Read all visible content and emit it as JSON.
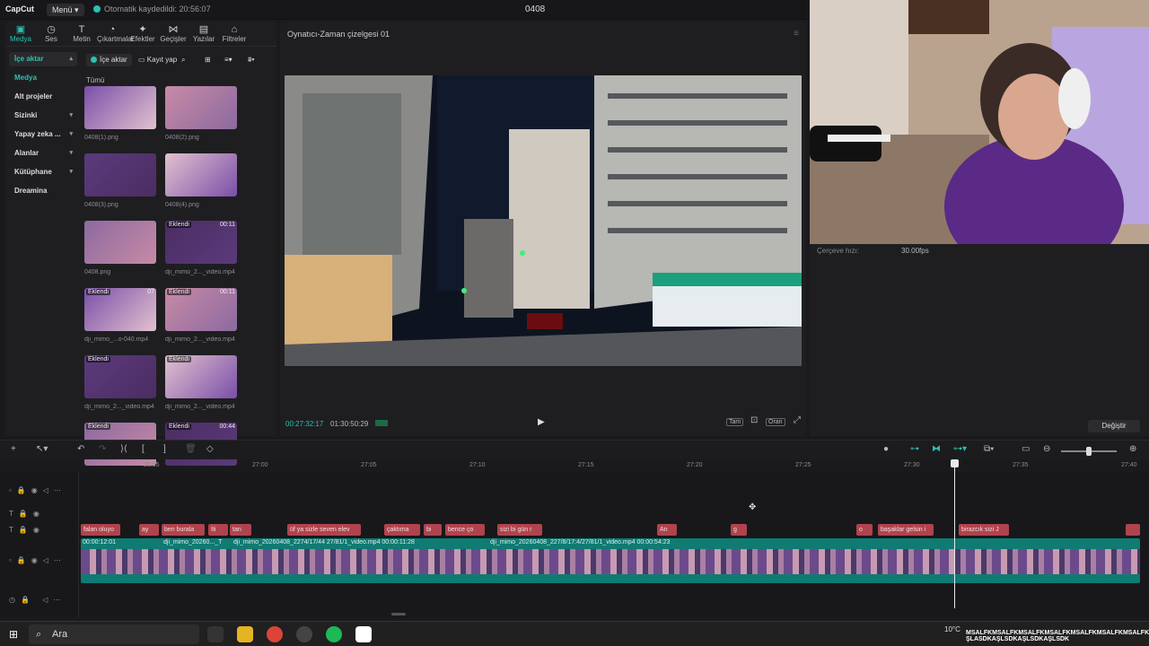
{
  "app": {
    "logo": "CapCut",
    "menu_label": "Menü",
    "autosave": "Otomatik kaydedildi: 20:56:07",
    "project_title": "0408"
  },
  "tool_tabs": [
    {
      "label": "Medya",
      "icon": "media-icon",
      "glyph": "▣",
      "active": true
    },
    {
      "label": "Ses",
      "icon": "audio-icon",
      "glyph": "◷"
    },
    {
      "label": "Metin",
      "icon": "text-icon",
      "glyph": "T"
    },
    {
      "label": "Çıkartmalar",
      "icon": "sticker-icon",
      "glyph": "◔"
    },
    {
      "label": "Efektler",
      "icon": "effects-icon",
      "glyph": "✦"
    },
    {
      "label": "Geçişler",
      "icon": "transitions-icon",
      "glyph": "⋈"
    },
    {
      "label": "Yazılar",
      "icon": "captions-icon",
      "glyph": "▤"
    },
    {
      "label": "Filtreler",
      "icon": "filters-icon",
      "glyph": "⌂"
    }
  ],
  "nav": [
    {
      "label": "İçe aktar",
      "state": "open"
    },
    {
      "label": "Medya",
      "state": "sub"
    },
    {
      "label": "Alt projeler",
      "state": ""
    },
    {
      "label": "Sizinki",
      "state": "caret"
    },
    {
      "label": "Yapay zeka ...",
      "state": "caret"
    },
    {
      "label": "Alanlar",
      "state": "caret"
    },
    {
      "label": "Kütüphane",
      "state": "caret"
    },
    {
      "label": "Dreamina",
      "state": ""
    }
  ],
  "media_toolbar": {
    "import": "İçe aktar",
    "record": "Kayıt yap"
  },
  "all_label": "Tümü",
  "media": [
    {
      "name": "0408(1).png",
      "badge": "",
      "dur": ""
    },
    {
      "name": "0408(2).png",
      "badge": "",
      "dur": ""
    },
    {
      "name": "0408(3).png",
      "badge": "",
      "dur": ""
    },
    {
      "name": "0408(4).png",
      "badge": "",
      "dur": ""
    },
    {
      "name": "0408.png",
      "badge": "",
      "dur": ""
    },
    {
      "name": "dji_mimo_2..._video.mp4",
      "badge": "Eklendi",
      "dur": "00:11"
    },
    {
      "name": "dji_mimo_...o-040.mp4",
      "badge": "Eklendi",
      "dur": "07"
    },
    {
      "name": "dji_mimo_2..._video.mp4",
      "badge": "Eklendi",
      "dur": "00:11"
    },
    {
      "name": "dji_mimo_2..._video.mp4",
      "badge": "Eklendi",
      "dur": ""
    },
    {
      "name": "dji_mimo_2..._video.mp4",
      "badge": "Eklendi",
      "dur": ""
    },
    {
      "name": "",
      "badge": "Eklendi",
      "dur": ""
    },
    {
      "name": "",
      "badge": "Eklendi",
      "dur": "00:44"
    }
  ],
  "player": {
    "title": "Oynatıcı-Zaman çizelgesi 01",
    "timecode_current": "00:27:32:17",
    "timecode_total": "01:30:50:29",
    "btn_full": "Tam",
    "btn_ratio": "Oran"
  },
  "details": {
    "fps_label": "Çerçeve hızı:",
    "fps_value": "30.00fps",
    "change_button": "Değiştir"
  },
  "ruler": [
    "26:55",
    "27:00",
    "27:05",
    "27:10",
    "27:15",
    "27:20",
    "27:25",
    "27:30",
    "27:35",
    "27:40"
  ],
  "captions": [
    {
      "text": "falan oluyo"
    },
    {
      "text": "ay"
    },
    {
      "text": "ben burala"
    },
    {
      "text": "İti"
    },
    {
      "text": "tan"
    },
    {
      "text": "üf ya sizle seven elev"
    },
    {
      "text": "çaktıma"
    },
    {
      "text": "bi"
    },
    {
      "text": "bence ço"
    },
    {
      "text": "sizi bi gün r"
    },
    {
      "text": "An"
    },
    {
      "text": "g"
    },
    {
      "text": "o"
    },
    {
      "text": "başaklar gelsin i"
    },
    {
      "text": "birazcık sizi J"
    },
    {
      "text": ""
    }
  ],
  "clips": [
    {
      "label": "00:00:12:01"
    },
    {
      "label": "dji_mimo_20260..._T"
    },
    {
      "label": "dji_mimo_20260408_2274/17/44 27/81/1_video.mp4  00:00:11:28"
    },
    {
      "label": "dji_mimo_20260408_227/8/17:4/27/81/1_video.mp4  00:00:54:23"
    }
  ],
  "taskbar": {
    "search": "Ara",
    "weather": "10°C",
    "ticker": "MSALFKMSALFKMSALFKMSALFKMSALFKMSALFKMSALFKMSALFA ŞLASDKAŞLSDKAŞLSDKAŞLSDK"
  }
}
